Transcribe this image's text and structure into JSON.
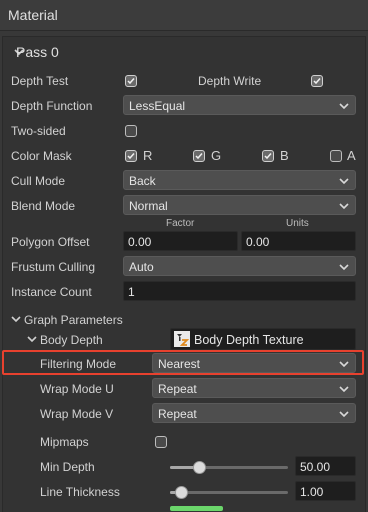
{
  "panel": {
    "title": "Material"
  },
  "pass": {
    "title": "Pass 0"
  },
  "depth_test": {
    "label": "Depth Test",
    "checked": true
  },
  "depth_write": {
    "label": "Depth Write",
    "checked": true
  },
  "depth_function": {
    "label": "Depth Function",
    "value": "LessEqual"
  },
  "two_sided": {
    "label": "Two-sided",
    "checked": false
  },
  "color_mask": {
    "label": "Color Mask",
    "r": "R",
    "g": "G",
    "b": "B",
    "a": "A",
    "r_checked": true,
    "g_checked": true,
    "b_checked": true,
    "a_checked": false
  },
  "cull_mode": {
    "label": "Cull Mode",
    "value": "Back"
  },
  "blend_mode": {
    "label": "Blend Mode",
    "value": "Normal"
  },
  "polygon_offset": {
    "label": "Polygon Offset",
    "factor_label": "Factor",
    "units_label": "Units",
    "factor": "0.00",
    "units": "0.00"
  },
  "frustum_culling": {
    "label": "Frustum Culling",
    "value": "Auto"
  },
  "instance_count": {
    "label": "Instance Count",
    "value": "1"
  },
  "graph_parameters": {
    "title": "Graph Parameters",
    "body_depth": {
      "label": "Body Depth",
      "texture": "Body Depth Texture"
    },
    "filtering_mode": {
      "label": "Filtering Mode",
      "value": "Nearest"
    },
    "wrap_mode_u": {
      "label": "Wrap Mode U",
      "value": "Repeat"
    },
    "wrap_mode_v": {
      "label": "Wrap Mode V",
      "value": "Repeat"
    },
    "mipmaps": {
      "label": "Mipmaps",
      "checked": false
    },
    "min_depth": {
      "label": "Min Depth",
      "value": "50.00",
      "slider_fraction": 0.22
    },
    "line_thickness": {
      "label": "Line Thickness",
      "value": "1.00",
      "slider_fraction": 0.05
    }
  },
  "colors": {
    "highlight": "#e8412e",
    "accent_green": "#6bd66b"
  }
}
